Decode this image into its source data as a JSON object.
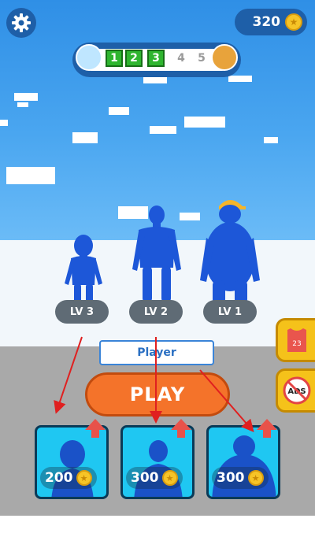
{
  "hud": {
    "coins": "320",
    "coin_symbol": "★",
    "icons": {
      "settings": "gear-icon",
      "currency": "coin-icon"
    }
  },
  "progress": {
    "steps": [
      {
        "label": "1",
        "state": "done"
      },
      {
        "label": "2",
        "state": "done"
      },
      {
        "label": "3",
        "state": "done"
      },
      {
        "label": "4",
        "state": "todo"
      },
      {
        "label": "5",
        "state": "todo"
      }
    ]
  },
  "characters": [
    {
      "level": "LV 3"
    },
    {
      "level": "LV 2"
    },
    {
      "level": "LV 1"
    }
  ],
  "player_name": "Player",
  "play_label": "PLAY",
  "side_buttons": {
    "jersey_number": "23",
    "ads_label": "ADS"
  },
  "upgrades": [
    {
      "price": "200"
    },
    {
      "price": "300"
    },
    {
      "price": "300"
    }
  ],
  "colors": {
    "accent_blue": "#1e5fa8",
    "play_orange": "#f4732a",
    "card_cyan": "#1fc7f2",
    "character_blue": "#1d57d8",
    "progress_green": "#2fb52f"
  }
}
